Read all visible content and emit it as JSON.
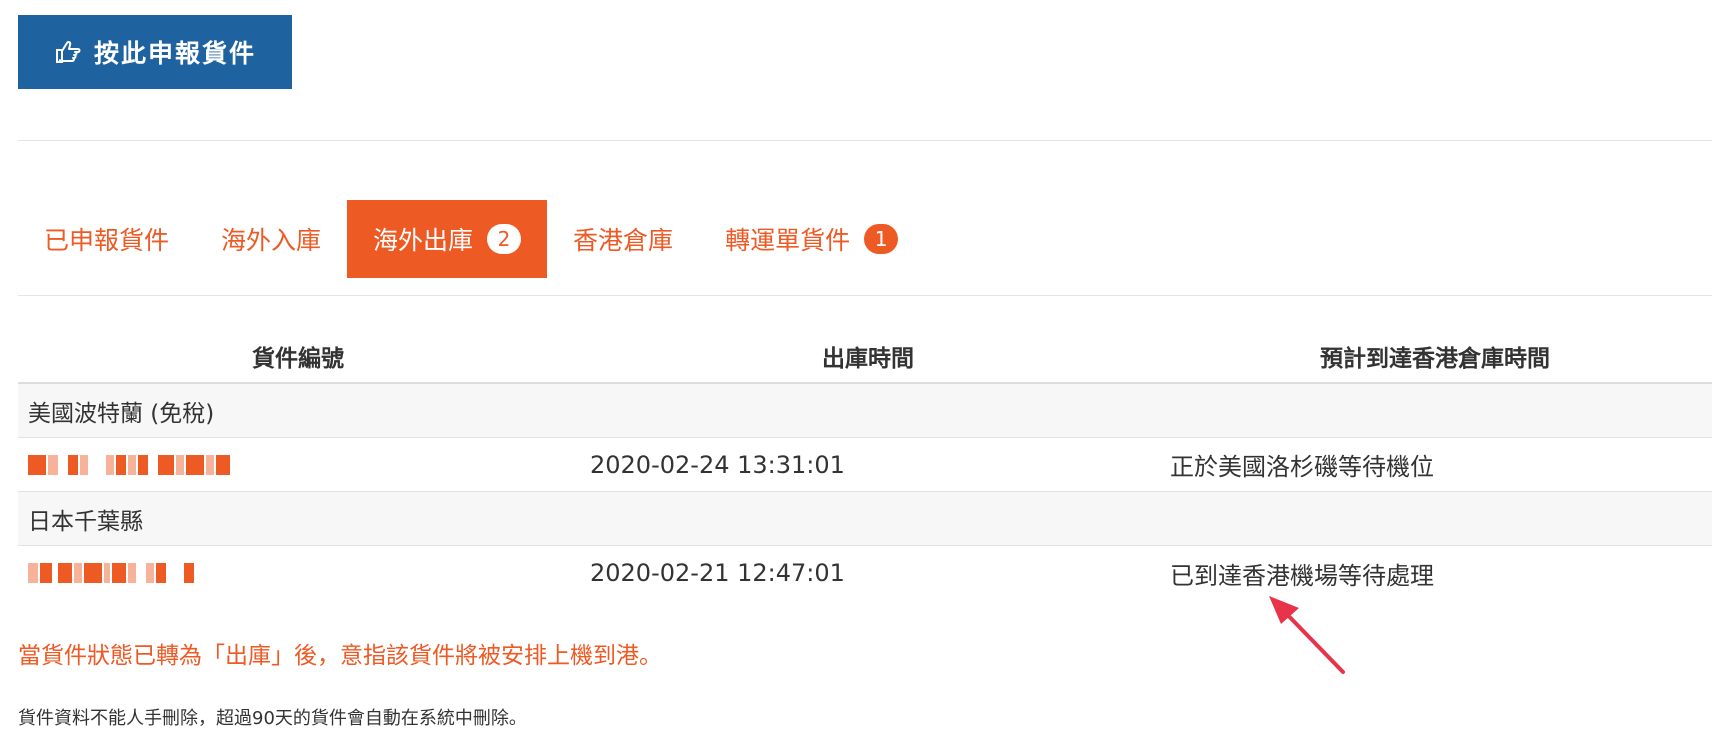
{
  "declare_button": {
    "label": "按此申報貨件",
    "icon": "hand-pointing-icon"
  },
  "tabs": [
    {
      "label": "已申報貨件",
      "badge": ""
    },
    {
      "label": "海外入庫",
      "badge": ""
    },
    {
      "label": "海外出庫",
      "badge": "2",
      "active": true
    },
    {
      "label": "香港倉庫",
      "badge": ""
    },
    {
      "label": "轉運單貨件",
      "badge": "1"
    }
  ],
  "table": {
    "headers": [
      "貨件編號",
      "出庫時間",
      "預計到達香港倉庫時間"
    ],
    "groups": [
      {
        "name": "美國波特蘭 (免稅)",
        "rows": [
          {
            "tracking": "[redacted]",
            "out_time": "2020-02-24 13:31:01",
            "eta_status": "正於美國洛杉磯等待機位"
          }
        ]
      },
      {
        "name": "日本千葉縣",
        "rows": [
          {
            "tracking": "[redacted]",
            "out_time": "2020-02-21 12:47:01",
            "eta_status": "已到達香港機場等待處理"
          }
        ]
      }
    ]
  },
  "notice": "當貨件狀態已轉為「出庫」後，意指該貨件將被安排上機到港。",
  "footnote": "貨件資料不能人手刪除，超過90天的貨件會自動在系統中刪除。",
  "colors": {
    "primary": "#1f62a0",
    "accent": "#ee5a24",
    "arrow": "#e8334a"
  }
}
